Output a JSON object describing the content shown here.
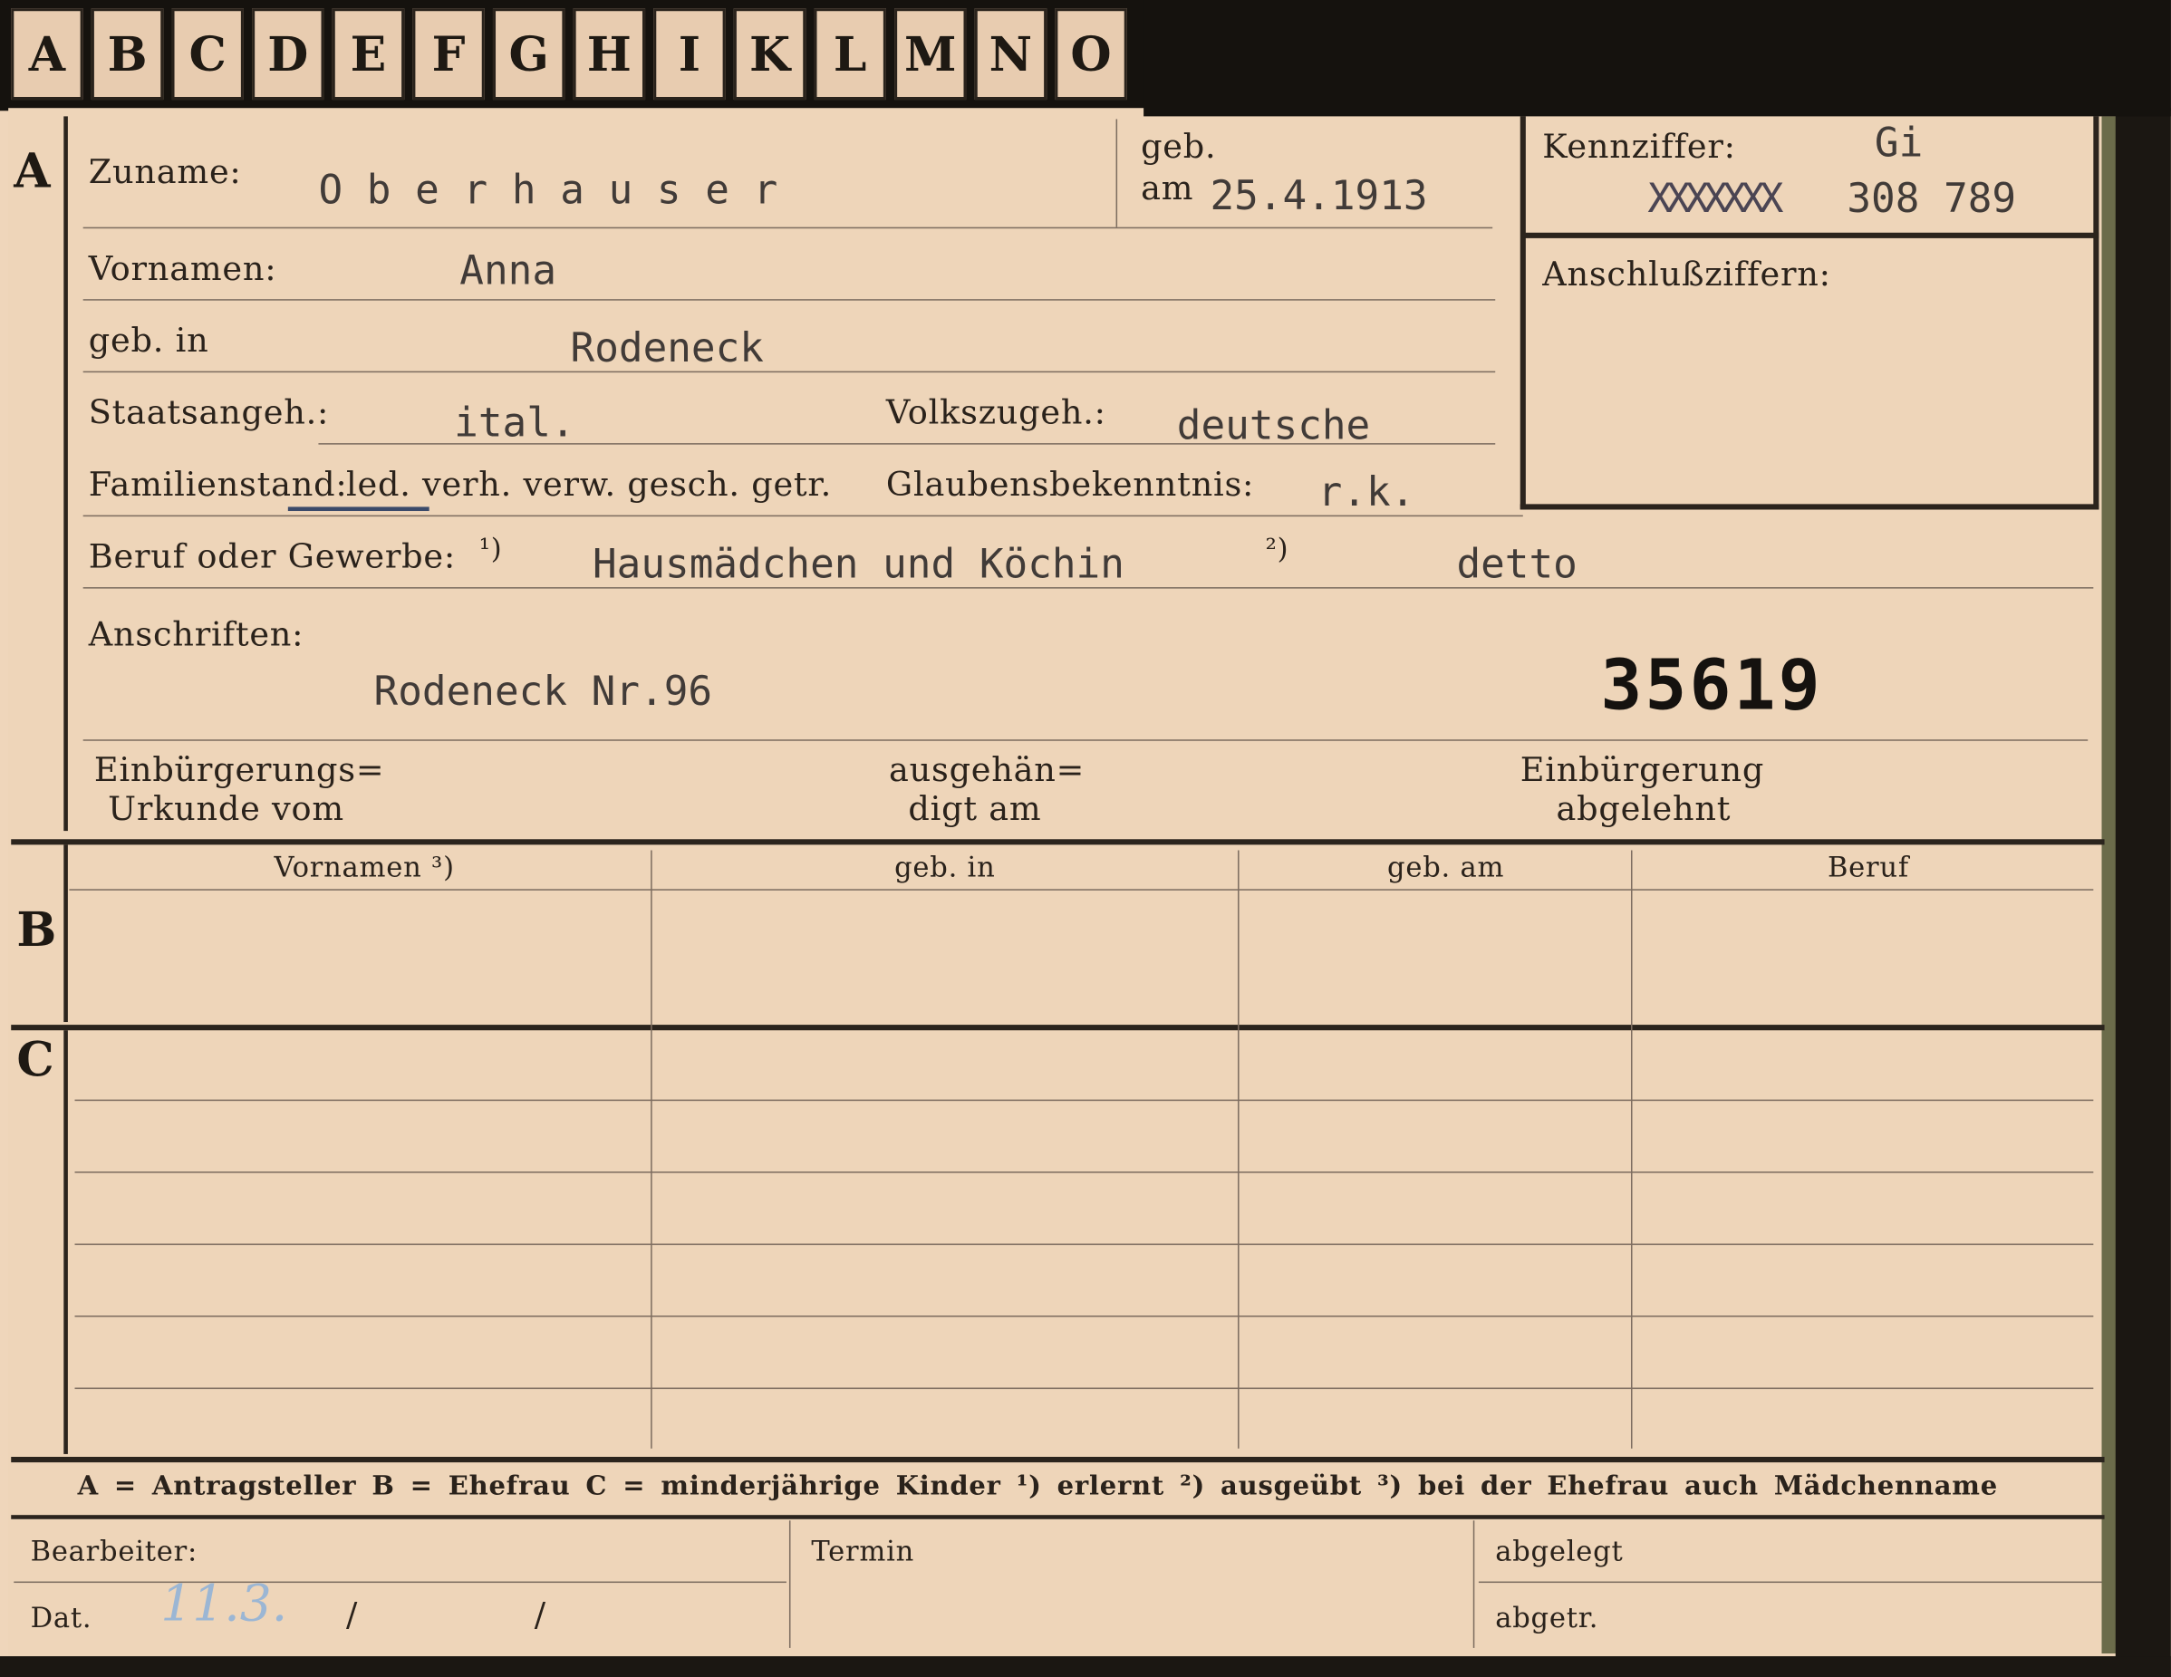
{
  "tabs": [
    "A",
    "B",
    "C",
    "D",
    "E",
    "F",
    "G",
    "H",
    "I",
    "K",
    "L",
    "M",
    "N",
    "O"
  ],
  "sections": {
    "a": "A",
    "b": "B",
    "c": "C"
  },
  "labels": {
    "zuname": "Zuname:",
    "geb": "geb.",
    "am": "am",
    "kennziffer": "Kennziffer:",
    "vornamen": "Vornamen:",
    "anschluss": "Anschlußziffern:",
    "geb_in": "geb. in",
    "staats": "Staatsangeh.:",
    "volks": "Volkszugeh.:",
    "familienstand": "Familienstand:",
    "fam_options": "led. verh. verw. gesch. getr.",
    "glauben": "Glaubensbekenntnis:",
    "beruf": "Beruf oder Gewerbe:",
    "fn1": "¹)",
    "fn2": "²)",
    "anschriften": "Anschriften:",
    "einb_urkunde_1": "Einbürgerungs=",
    "einb_urkunde_2": "Urkunde vom",
    "ausgeh_1": "ausgehän=",
    "ausgeh_2": "digt am",
    "abgelehnt_1": "Einbürgerung",
    "abgelehnt_2": "abgelehnt"
  },
  "values": {
    "zuname": "O b e r h a u s e r",
    "geb_am": "25.4.1913",
    "kenn_prefix": "Gi",
    "kenn_struck": "XXXXXXX",
    "kenn_number": "308 789",
    "vornamen": "Anna",
    "geb_in": "Rodeneck",
    "staats": "ital.",
    "volks": "deutsche",
    "glauben": "r.k.",
    "beruf_erlernt": "Hausmädchen  und Köchin",
    "beruf_ausgeuebt": "detto",
    "anschrift": "Rodeneck  Nr.96",
    "stamp_number": "35619"
  },
  "table": {
    "headers": [
      "Vornamen ³)",
      "geb. in",
      "geb. am",
      "Beruf"
    ]
  },
  "legend": "A = Antragsteller   B = Ehefrau   C = minderjährige Kinder   ¹) erlernt   ²) ausgeübt   ³) bei der Ehefrau auch Mädchenname",
  "footer": {
    "bearbeiter": "Bearbeiter:",
    "termin": "Termin",
    "abgelegt": "abgelegt",
    "dat": "Dat.",
    "abgetr": "abgetr.",
    "dat_hand": "11.3.",
    "slash1": "/",
    "slash2": "/"
  },
  "colors": {
    "paper": "#eed5b9",
    "ink": "#2a221b",
    "typewriter": "#413b38",
    "pencil_blue": "#9bb6d4"
  }
}
